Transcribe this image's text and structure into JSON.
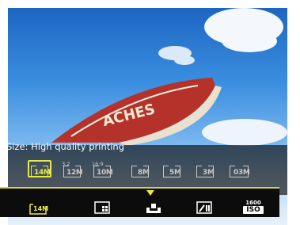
{
  "menu": {
    "title": "Size: High quality printing"
  },
  "size_options": [
    {
      "label": "14M",
      "ratio": "",
      "selected": true
    },
    {
      "label": "12M",
      "ratio": "3:2",
      "selected": false
    },
    {
      "label": "10M",
      "ratio": "16:9",
      "selected": false
    },
    {
      "label": "8M",
      "ratio": "",
      "selected": false
    },
    {
      "label": "5M",
      "ratio": "",
      "selected": false
    },
    {
      "label": "3M",
      "ratio": "",
      "selected": false
    },
    {
      "label": "03M",
      "ratio": "",
      "selected": false
    }
  ],
  "bottom_bar": {
    "size_label": "14M",
    "iso_value": "1600",
    "iso_label": "ISO"
  },
  "scene": {
    "boat_text": "ACHES"
  },
  "colors": {
    "accent": "#e8e84a",
    "panel": "#000000"
  }
}
